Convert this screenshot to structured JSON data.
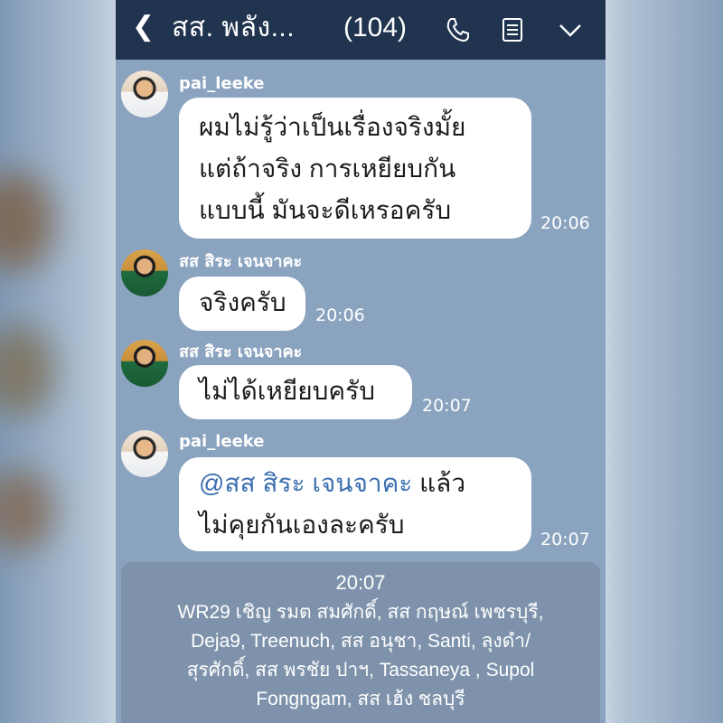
{
  "header": {
    "back_icon": "chevron-left-icon",
    "title": "สส. พลัง...",
    "member_count": "(104)",
    "icons": [
      "phone-icon",
      "notes-icon",
      "chevron-down-icon"
    ],
    "bg_color": "#21344f"
  },
  "messages": [
    {
      "sender": "pai_leeke",
      "lines": [
        "ผมไม่รู้ว่าเป็นเรื่องจริงมั้ย",
        "แต่ถ้าจริง  การเหยียบกัน",
        "แบบนี้  มันจะดีเหรอครับ"
      ],
      "time": "20:06"
    },
    {
      "sender": "สส สิระ เจนจาคะ",
      "lines": [
        "จริงครับ"
      ],
      "time": "20:06"
    },
    {
      "sender": "สส สิระ เจนจาคะ",
      "lines": [
        "ไม่ได้เหยียบครับ"
      ],
      "time": "20:07"
    },
    {
      "sender": "pai_leeke",
      "mention": "@สส สิระ เจนจาคะ",
      "mention_tail": " แล้ว",
      "lines": [
        "ไม่คุยกันเองละครับ"
      ],
      "time": "20:07"
    }
  ],
  "notice": {
    "time": "20:07",
    "lines": [
      "WR29 เชิญ รมต สมศักดิ์, สส กฤษณ์ เพชรบุรี,",
      "Deja9, Treenuch, สส อนุชา, Santi, ลุงดำ/",
      "สุรศักดิ์, สส พรชัย ปาฯ, Tassaneya , Supol",
      "Fongngam, สส เฮ้ง ชลบุรี"
    ]
  },
  "colors": {
    "chat_bg": "#8aa3bf",
    "bubble": "#ffffff",
    "mention": "#3b6fb0",
    "notice_bg": "#7e93ab"
  }
}
